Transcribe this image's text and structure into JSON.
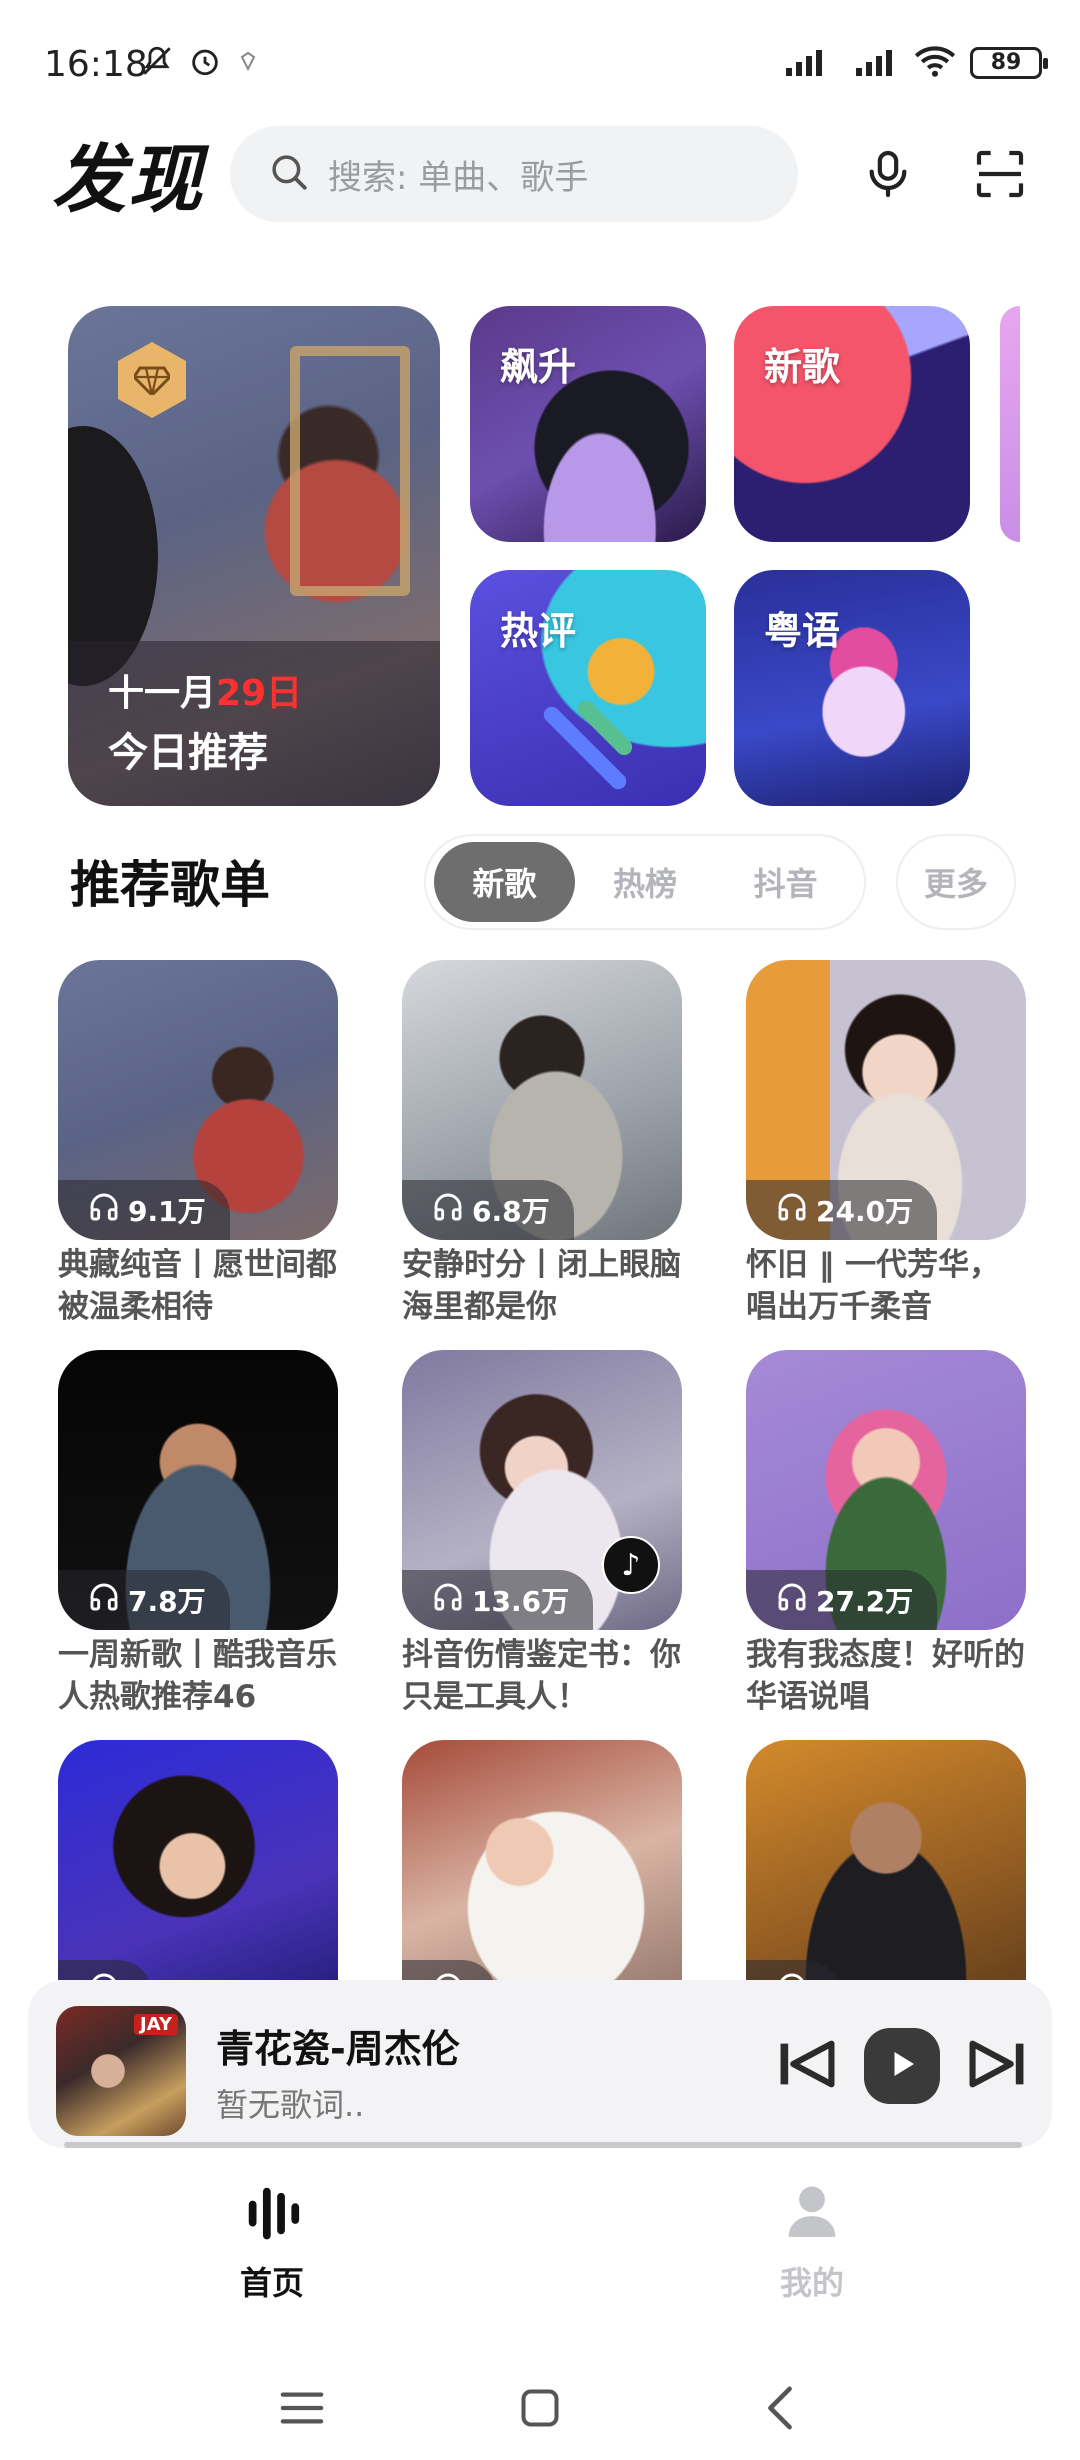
{
  "status_bar": {
    "time": "16:18",
    "battery": "89"
  },
  "header": {
    "title": "发现",
    "search_placeholder": "搜索: 单曲、歌手"
  },
  "banner": {
    "hero": {
      "month": "十一月",
      "day": "29日",
      "title": "今日推荐"
    },
    "tiles": [
      {
        "label": "飙升"
      },
      {
        "label": "新歌"
      },
      {
        "label": "热评"
      },
      {
        "label": "粤语"
      }
    ]
  },
  "playlists_section": {
    "title": "推荐歌单",
    "tabs": [
      "新歌",
      "热榜",
      "抖音"
    ],
    "active_tab": "新歌",
    "more": "更多"
  },
  "playlists": [
    {
      "count": "9.1万",
      "name": "典藏纯音丨愿世间都被温柔相待"
    },
    {
      "count": "6.8万",
      "name": "安静时分丨闭上眼脑海里都是你"
    },
    {
      "count": "24.0万",
      "name": "怀旧 ‖ 一代芳华，唱出万千柔音"
    },
    {
      "count": "7.8万",
      "name": "一周新歌丨酷我音乐人热歌推荐46"
    },
    {
      "count": "13.6万",
      "name": "抖音伤情鉴定书：你只是工具人！"
    },
    {
      "count": "27.2万",
      "name": "我有我态度！好听的华语说唱"
    },
    {
      "count": "",
      "name": ""
    },
    {
      "count": "",
      "name": ""
    },
    {
      "count": "",
      "name": ""
    }
  ],
  "mini_player": {
    "title": "青花瓷-周杰伦",
    "lyric": "暂无歌词..",
    "cover_badge": "JAY"
  },
  "bottom_nav": {
    "items": [
      {
        "label": "首页"
      },
      {
        "label": "我的"
      }
    ]
  },
  "colors": {
    "accent_active": "#111111",
    "inactive": "#c4c5c9",
    "hero_day": "#ff3030"
  }
}
